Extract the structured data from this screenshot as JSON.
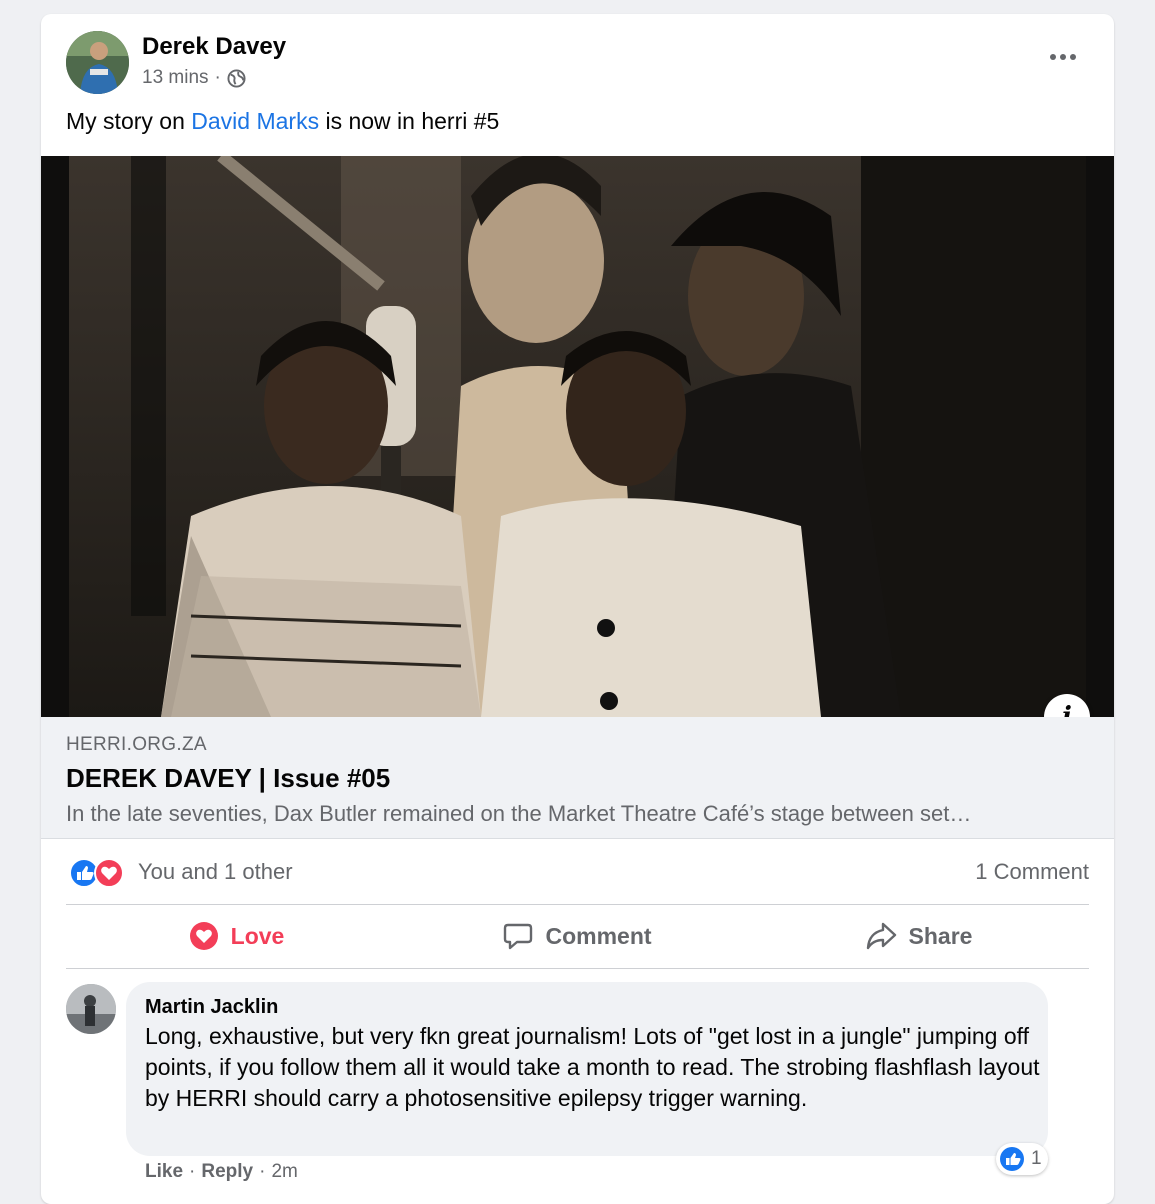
{
  "post": {
    "author": "Derek Davey",
    "time": "13 mins",
    "separator": "·",
    "privacy_icon": "globe-icon",
    "text_before": "My story on ",
    "text_link": "David Marks",
    "text_after": " is now in herri #5"
  },
  "link_preview": {
    "domain": "HERRI.ORG.ZA",
    "title": "DEREK DAVEY | Issue #05",
    "description": "In the late seventies, Dax Butler remained on the Market Theatre Café’s stage between set…",
    "info_glyph": "i"
  },
  "engagement": {
    "reaction_icons": [
      "like-icon",
      "love-icon"
    ],
    "reaction_summary": "You and 1 other",
    "comment_count": "1 Comment"
  },
  "actions": {
    "love": "Love",
    "comment": "Comment",
    "share": "Share"
  },
  "comment": {
    "author": "Martin Jacklin",
    "text": "Long, exhaustive, but very fkn great journalism! Lots of \"get lost in a jungle\" jumping off points, if you follow them all it would take a month to read. The strobing flashflash layout by HERRI should carry a photosensitive epilepsy trigger warning.",
    "reaction_count": "1",
    "like": "Like",
    "reply": "Reply",
    "dot": "·",
    "time": "2m"
  },
  "colors": {
    "link_blue": "#1b74e4",
    "love_red": "#f33e58",
    "secondary_text": "#65676b",
    "background": "#eff0f3"
  }
}
